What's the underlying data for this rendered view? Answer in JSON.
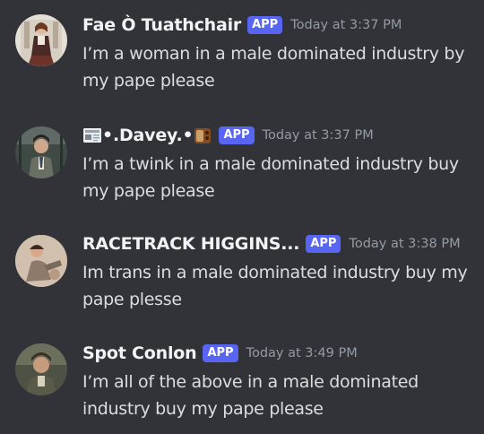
{
  "messages": [
    {
      "username": "Fae Ò Tuathchair",
      "badge": "APP",
      "timestamp": "Today at 3:37 PM",
      "text": "I’m a woman in a male dominated industry by my pape please"
    },
    {
      "username": ".Davey.",
      "username_prefix_emoji": "newspaper-emoji",
      "username_bullet": "•",
      "username_suffix_emoji": "radio-emoji",
      "badge": "APP",
      "timestamp": "Today at 3:37 PM",
      "text": "I’m a twink in a male dominated industry buy my pape please"
    },
    {
      "username": "RACETRACK HIGGINS...",
      "badge": "APP",
      "timestamp": "Today at 3:38 PM",
      "text": "Im trans in a male dominated industry buy my pape plesse"
    },
    {
      "username": "Spot Conlon",
      "badge": "APP",
      "timestamp": "Today at 3:49 PM",
      "text": "I’m all of the above in a male dominated industry buy my pape please"
    }
  ],
  "colors": {
    "background": "#313338",
    "username": "#f2f3f5",
    "message_text": "#dbdee1",
    "timestamp": "#949ba4",
    "app_badge": "#5865f2"
  }
}
